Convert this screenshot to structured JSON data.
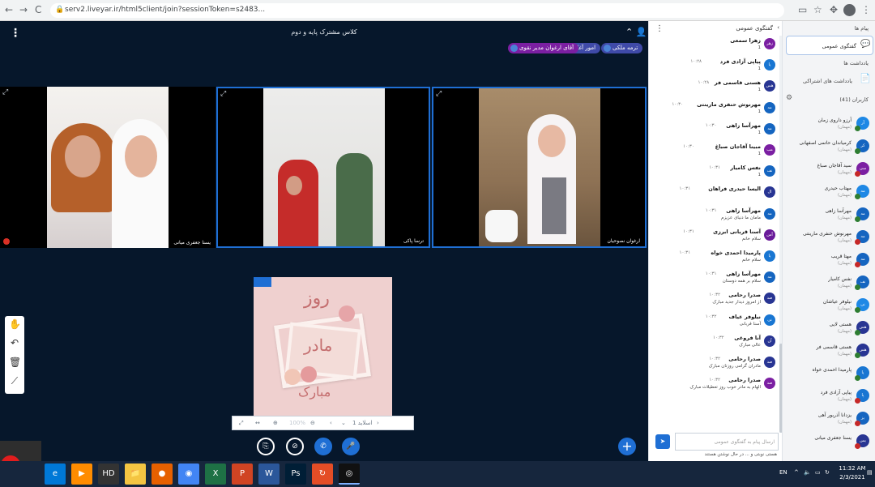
{
  "browser": {
    "url": "serv2.liveyar.ir/html5client/join?sessionToken=s2483...",
    "nav_back": "←",
    "nav_forward": "→",
    "nav_reload": "C"
  },
  "meeting": {
    "title": "کلاس مشترک پایه و دوم",
    "pills": [
      "ترمه ملکی",
      "امور آغاز",
      "آقای ارغوان مدیر نقوی"
    ]
  },
  "videos": [
    {
      "caption": "یسنا جعفری میانی"
    },
    {
      "caption": "ترسا پاکی"
    },
    {
      "caption": "ارغوان نصوحیان"
    }
  ],
  "presentation": {
    "line1": "روز",
    "line2": "مادر",
    "line3": "مبارک",
    "slide_label": "اسلاید 1",
    "page": "1"
  },
  "tools": [
    "hand-tool",
    "undo",
    "delete",
    "chart"
  ],
  "actions": {
    "screen_share": "⎘",
    "camera": "⊘",
    "phone": "✆",
    "mic": "🎤",
    "plus": "+"
  },
  "chat": {
    "title": "گفتگوی عمومی",
    "placeholder": "ارسال پیام به گفتگوی عمومی",
    "typing": "هستی نوبتی و ... در حال نوشتن هستند",
    "messages": [
      {
        "name": "زهرا سمعی",
        "time": "",
        "text": "1",
        "av": "زهر",
        "color": "#7b1fa2"
      },
      {
        "name": "پیاپی آزادی فرد",
        "time": "۱۰:۲۸",
        "text": "1",
        "av": "پا",
        "color": "#1976d2"
      },
      {
        "name": "هستی قاسمی فر",
        "time": "۱۰:۲۸",
        "text": "1",
        "av": "هس",
        "color": "#283593"
      },
      {
        "name": "مهرنوش حنفری مارینتی",
        "time": "۱۰:۳۰",
        "text": "1",
        "av": "مه",
        "color": "#1565c0"
      },
      {
        "name": "مهرآسا زاهی",
        "time": "۱۰:۳۰",
        "text": "1",
        "av": "مه",
        "color": "#1565c0"
      },
      {
        "name": "مبینا آقاجان صباغ",
        "time": "۱۰:۳۰",
        "text": "1",
        "av": "مب",
        "color": "#7b1fa2"
      },
      {
        "name": "نفس کامیار",
        "time": "۱۰:۳۱",
        "text": "1",
        "av": "نف",
        "color": "#1565c0"
      },
      {
        "name": "الیسا حیدری فراهان",
        "time": "۱۰:۳۱",
        "text": "",
        "av": "ال",
        "color": "#283593"
      },
      {
        "name": "مهرآسا زاهی",
        "time": "۱۰:۳۱",
        "text": "مامان ما دنیای عزیزم",
        "av": "مه",
        "color": "#1565c0"
      },
      {
        "name": "آسنا قربانی ابرزی",
        "time": "۱۰:۳۱",
        "text": "سلام خانم",
        "av": "آس",
        "color": "#6a1b9a"
      },
      {
        "name": "پارمیدا احمدی خواه",
        "time": "۱۰:۳۱",
        "text": "سلام خانم",
        "av": "پا",
        "color": "#1976d2"
      },
      {
        "name": "مهرآسا زاهی",
        "time": "۱۰:۳۱",
        "text": "سلام بر همه دوستان",
        "av": "مه",
        "color": "#1565c0"
      },
      {
        "name": "صدرا رحامی",
        "time": "۱۰:۳۲",
        "text": "از امروز دیدار جدید مبارک",
        "av": "صد",
        "color": "#283593"
      },
      {
        "name": "نیلوفر غیاف",
        "time": "۱۰:۳۲",
        "text": "آسنا قربانی",
        "av": "نی",
        "color": "#1976d2"
      },
      {
        "name": "آنا فروغی",
        "time": "۱۰:۳۲",
        "text": "عالی مبارک",
        "av": "آن",
        "color": "#283593"
      },
      {
        "name": "صدرا رحامی",
        "time": "۱۰:۳۲",
        "text": "مادران گرامی روزتان مبارک",
        "av": "صد",
        "color": "#283593"
      },
      {
        "name": "صدرا رحامی",
        "time": "۱۰:۳۲",
        "text": "الهام به مادر خوب روز تعطیلات مبارک",
        "av": "صد",
        "color": "#7b1fa2"
      }
    ]
  },
  "users": {
    "messages_title": "پیام ها",
    "active_item": "گفتگوی عمومی",
    "notes_title": "یادداشت ها",
    "shared_notes": "یادداشت های اشتراکی",
    "participants_title": "کاربران (41)",
    "list": [
      {
        "name": "آرزو داروی زمان",
        "sub": "(مهمان)",
        "av": "آر",
        "color": "#1e88e5",
        "st": "#2e7d32"
      },
      {
        "name": "کرمیاندان حاتمی اصفهانی",
        "sub": "(مهمان)",
        "av": "کر",
        "color": "#1565c0",
        "st": "#2e7d32"
      },
      {
        "name": "سید آقاجان صباغ",
        "sub": "(مهمان)",
        "av": "سی",
        "color": "#7b1fa2",
        "st": "#c62828"
      },
      {
        "name": "مهتاب حیدری",
        "sub": "(مهمان)",
        "av": "مه",
        "color": "#1e88e5",
        "st": "#2e7d32"
      },
      {
        "name": "مهرآسا زاهی",
        "sub": "(مهمان)",
        "av": "مه",
        "color": "#1565c0",
        "st": "#2e7d32"
      },
      {
        "name": "مهرنوش حنفری مارینتی",
        "sub": "(مهمان)",
        "av": "مه",
        "color": "#1565c0",
        "st": "#c62828"
      },
      {
        "name": "مهتا قریب",
        "sub": "(مهمان)",
        "av": "مه",
        "color": "#1565c0",
        "st": "#c62828"
      },
      {
        "name": "نفس کامیار",
        "sub": "(مهمان)",
        "av": "نف",
        "color": "#1565c0",
        "st": "#2e7d32"
      },
      {
        "name": "نیلوفر عیاشان",
        "sub": "(مهمان)",
        "av": "نی",
        "color": "#1e88e5",
        "st": "#2e7d32"
      },
      {
        "name": "هستی لایی",
        "sub": "(مهمان)",
        "av": "هس",
        "color": "#283593",
        "st": "#2e7d32"
      },
      {
        "name": "هستی قاسمی فر",
        "sub": "(مهمان)",
        "av": "هس",
        "color": "#283593",
        "st": "#2e7d32"
      },
      {
        "name": "پارمیدا احمدی خواه",
        "sub": "",
        "av": "پا",
        "color": "#1976d2",
        "st": "#2e7d32"
      },
      {
        "name": "پیاپی آزادی فرد",
        "sub": "(مهمان)",
        "av": "پا",
        "color": "#1976d2",
        "st": "#c62828"
      },
      {
        "name": "یزدانا آذربور آهی",
        "sub": "(مهمان)",
        "av": "یز",
        "color": "#1565c0",
        "st": "#c62828"
      },
      {
        "name": "یسنا جعفری میانی",
        "sub": "",
        "av": "یس",
        "color": "#283593",
        "st": "#c62828"
      }
    ]
  },
  "taskbar": {
    "rec": "REC",
    "apps": [
      "e",
      "▶",
      "HD",
      "📁",
      "●",
      "◉",
      "X",
      "P",
      "W",
      "Ps",
      "↻",
      "◎"
    ],
    "lang": "EN",
    "time": "11:32 AM",
    "date": "2/3/2021"
  }
}
